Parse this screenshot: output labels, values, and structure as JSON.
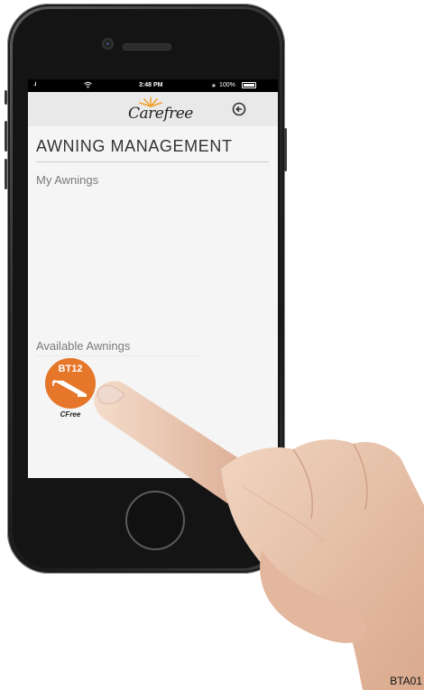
{
  "status_bar": {
    "signal": "..ıl",
    "time": "3:48 PM",
    "bluetooth": "∗",
    "battery_percent": "100%",
    "battery_level": 1.0
  },
  "header": {
    "logo_text": "Carefree",
    "logo_color": "#f2a12a",
    "back_icon": "back-circle-icon"
  },
  "page": {
    "title": "AWNING MANAGEMENT"
  },
  "sections": {
    "my_awnings": "My Awnings",
    "available_awnings": "Available Awnings"
  },
  "available_awnings": [
    {
      "code": "BT12",
      "name": "CFree",
      "color": "#e5762a",
      "icon": "awning-icon"
    }
  ],
  "figure_code": "BTA01"
}
